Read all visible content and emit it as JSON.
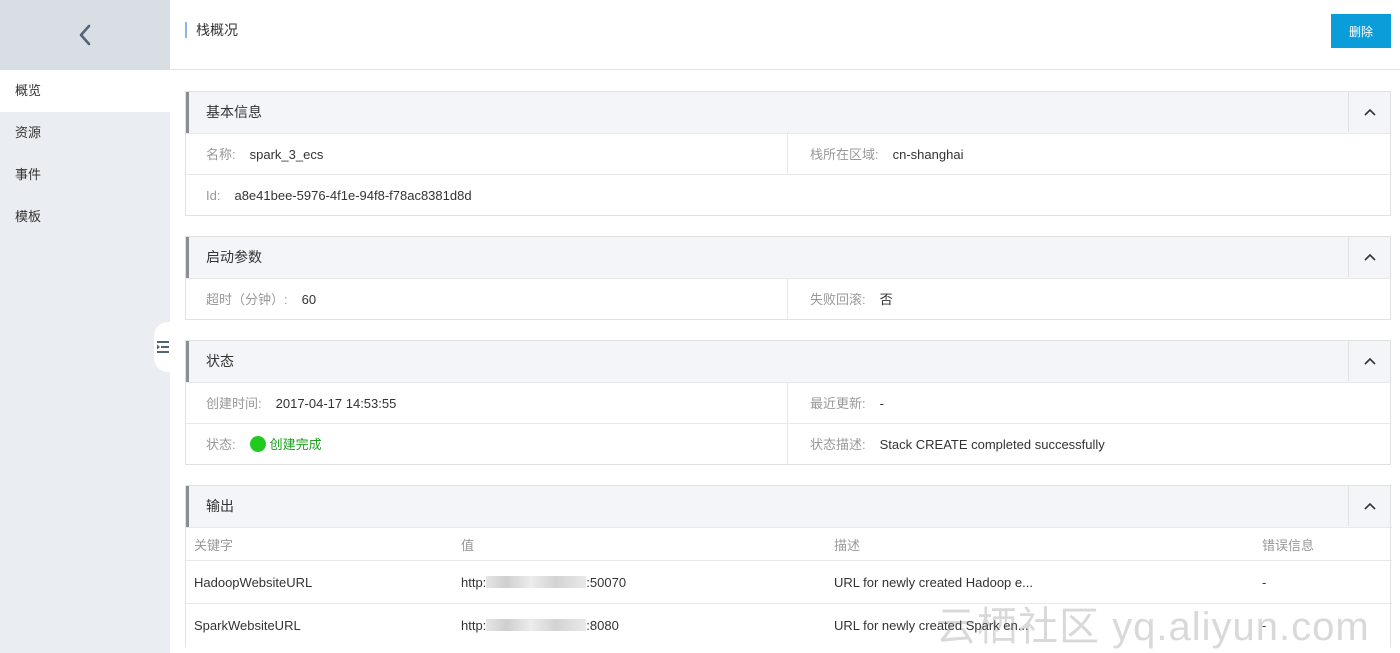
{
  "sidebar": {
    "items": [
      {
        "label": "概览"
      },
      {
        "label": "资源"
      },
      {
        "label": "事件"
      },
      {
        "label": "模板"
      }
    ]
  },
  "header": {
    "title": "栈概况",
    "delete_label": "删除"
  },
  "basic": {
    "title": "基本信息",
    "name_label": "名称:",
    "name_value": "spark_3_ecs",
    "region_label": "栈所在区域:",
    "region_value": "cn-shanghai",
    "id_label": "Id:",
    "id_value": "a8e41bee-5976-4f1e-94f8-f78ac8381d8d"
  },
  "params": {
    "title": "启动参数",
    "timeout_label": "超时（分钟）:",
    "timeout_value": "60",
    "rollback_label": "失败回滚:",
    "rollback_value": "否"
  },
  "status": {
    "title": "状态",
    "created_label": "创建时间:",
    "created_value": "2017-04-17 14:53:55",
    "updated_label": "最近更新:",
    "updated_value": "-",
    "state_label": "状态:",
    "state_value": "创建完成",
    "state_color": "#1ecb1e",
    "desc_label": "状态描述:",
    "desc_value": "Stack CREATE completed successfully"
  },
  "output": {
    "title": "输出",
    "columns": [
      "关键字",
      "值",
      "描述",
      "错误信息"
    ],
    "rows": [
      {
        "key": "HadoopWebsiteURL",
        "value_prefix": "http:",
        "value_suffix": ":50070",
        "desc": "URL for newly created Hadoop e...",
        "error": "-"
      },
      {
        "key": "SparkWebsiteURL",
        "value_prefix": "http:",
        "value_suffix": ":8080",
        "desc": "URL for newly created Spark en...",
        "error": "-"
      }
    ]
  },
  "watermark": "云栖社区 yq.aliyun.com",
  "colors": {
    "accent": "#0b9dd9",
    "sidebar_bg": "#eaedf1",
    "panel_header_bg": "#f4f5f9",
    "success": "#1ecb1e"
  }
}
